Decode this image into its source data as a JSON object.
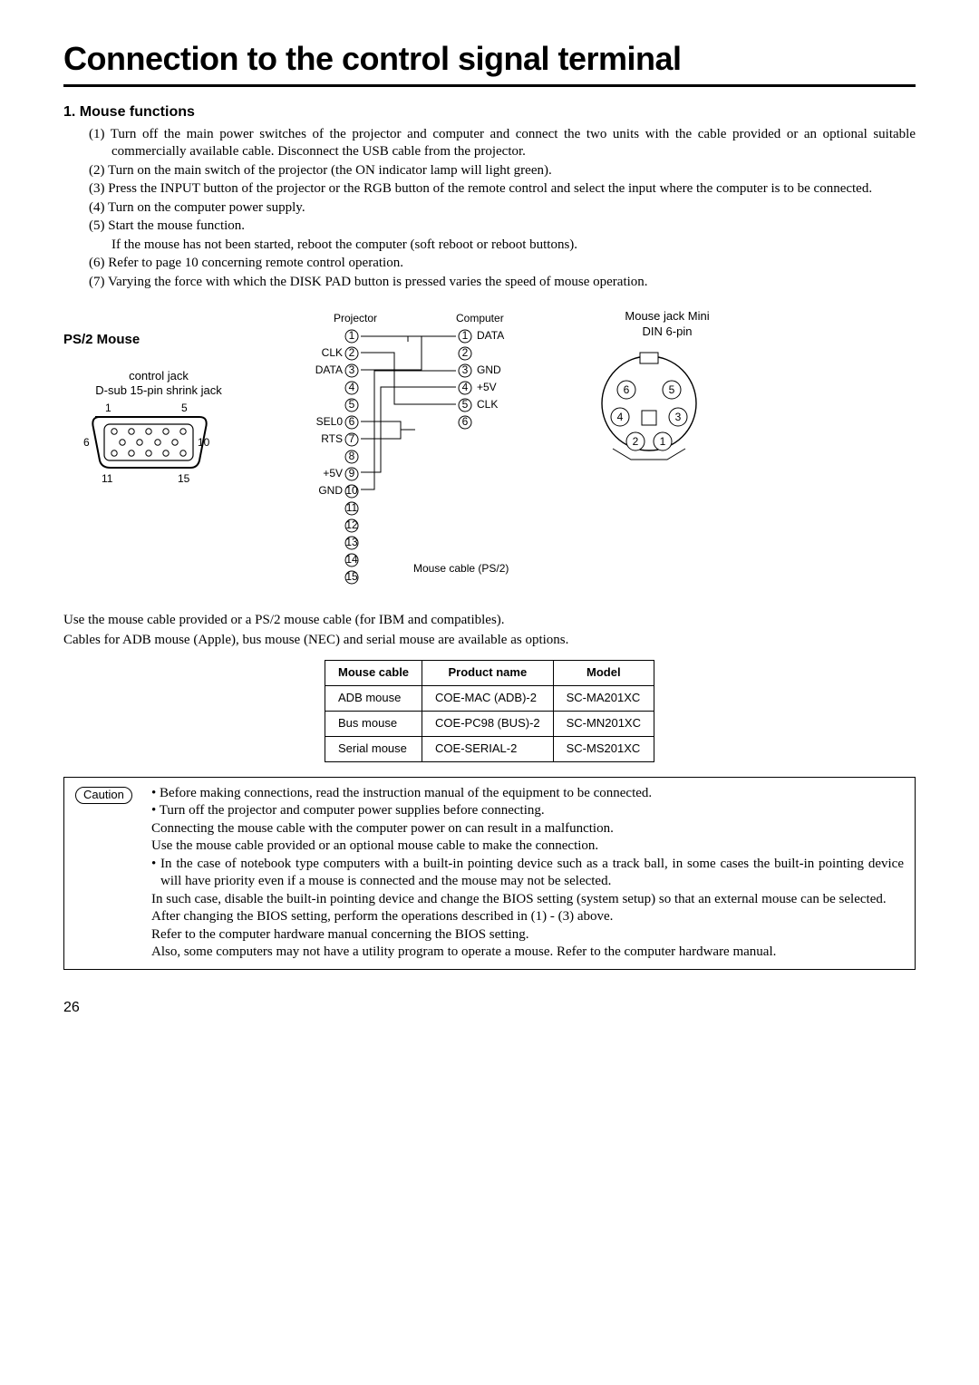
{
  "page_title": "Connection to the control signal terminal",
  "section1_title": "1.  Mouse functions",
  "steps": [
    "(1) Turn off the main power switches of the projector and computer and connect the two units with the cable provided or an optional suitable commercially available cable. Disconnect the USB cable from the projector.",
    "(2) Turn on the main switch of the projector (the ON indicator lamp will light green).",
    "(3) Press the INPUT button of the projector or the RGB button of the remote control and select the input where the computer is to be connected.",
    "(4) Turn on the computer power supply.",
    "(5) Start the mouse function.",
    "If the mouse has not been started, reboot the computer (soft reboot or reboot buttons).",
    "(6) Refer to page 10 concerning remote control operation.",
    "(7) Varying the force with which the DISK PAD button is pressed varies the speed of mouse operation."
  ],
  "diagram": {
    "ps2_title": "PS/2 Mouse",
    "control_jack_label": "control jack",
    "dsub_label": "D-sub 15-pin shrink jack",
    "projector_label": "Projector",
    "computer_label": "Computer",
    "mouse_jack_label": "Mouse jack  Mini",
    "din_label": "DIN 6-pin",
    "mouse_cable_label": "Mouse cable (PS/2)",
    "proj_pins": {
      "2": "CLK",
      "3": "DATA",
      "6": "SEL0",
      "7": "RTS",
      "9": "+5V",
      "10": "GND"
    },
    "comp_pins": {
      "1": "DATA",
      "3": "GND",
      "4": "+5V",
      "5": "CLK"
    },
    "dsub_pins": [
      "1",
      "5",
      "6",
      "10",
      "11",
      "15"
    ],
    "din_pins": [
      "6",
      "5",
      "4",
      "3",
      "2",
      "1"
    ]
  },
  "body_text1": "Use the mouse cable provided or a PS/2 mouse cable (for IBM and compatibles).",
  "body_text2": "Cables for ADB  mouse (Apple), bus mouse (NEC) and serial mouse are available as options.",
  "table": {
    "headers": [
      "Mouse cable",
      "Product name",
      "Model"
    ],
    "rows": [
      [
        "ADB mouse",
        "COE-MAC (ADB)-2",
        "SC-MA201XC"
      ],
      [
        "Bus mouse",
        "COE-PC98 (BUS)-2",
        "SC-MN201XC"
      ],
      [
        "Serial mouse",
        "COE-SERIAL-2",
        "SC-MS201XC"
      ]
    ]
  },
  "caution": {
    "label": "Caution",
    "items": [
      "• Before making connections, read the instruction manual of the equipment to be connected.",
      "• Turn off the projector and computer power supplies before connecting.",
      "Connecting the mouse cable with the computer power on can result in a malfunction.",
      "Use the mouse cable provided or an optional mouse cable to make the connection.",
      "• In the case of notebook type computers with a built-in pointing device such as a track ball, in some cases the built-in pointing device will have priority even if a mouse is connected and the mouse may not be selected.",
      "In such case, disable the built-in pointing device and change the BIOS setting (system setup) so that an external mouse can be selected.",
      "After changing the BIOS setting, perform the operations described in (1) - (3) above.",
      "Refer to the computer hardware manual concerning the BIOS setting.",
      "Also, some computers may not have a utility program to operate a mouse. Refer to the computer hardware manual."
    ]
  },
  "page_num": "26"
}
